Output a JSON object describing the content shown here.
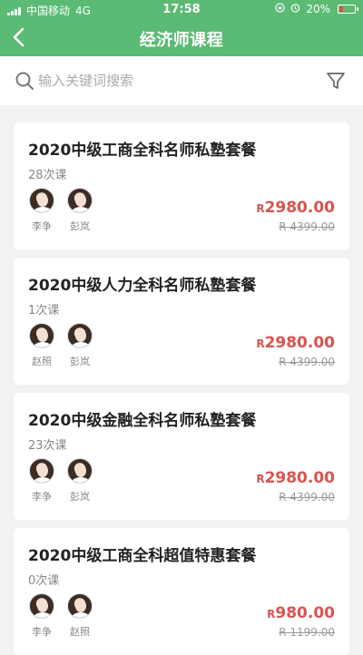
{
  "status_bar": {
    "carrier": "中国移动",
    "network": "4G",
    "time": "17:58",
    "battery": "20%",
    "battery_level": 0.2
  },
  "nav": {
    "title": "经济师课程"
  },
  "search": {
    "placeholder": "输入关键词搜索",
    "value": ""
  },
  "colors": {
    "header": "#5bba73",
    "price": "#d9534f"
  },
  "courses": [
    {
      "title": "2020中级工商全科名师私塾套餐",
      "count": "28次课",
      "teachers": [
        "李争",
        "彭岚"
      ],
      "currency": "R",
      "price": "2980.00",
      "original_price": "R 4399.00"
    },
    {
      "title": "2020中级人力全科名师私塾套餐",
      "count": "1次课",
      "teachers": [
        "赵照",
        "彭岚"
      ],
      "currency": "R",
      "price": "2980.00",
      "original_price": "R 4399.00"
    },
    {
      "title": "2020中级金融全科名师私塾套餐",
      "count": "23次课",
      "teachers": [
        "李争",
        "彭岚"
      ],
      "currency": "R",
      "price": "2980.00",
      "original_price": "R 4399.00"
    },
    {
      "title": "2020中级工商全科超值特惠套餐",
      "count": "0次课",
      "teachers": [
        "李争",
        "赵照"
      ],
      "currency": "R",
      "price": "980.00",
      "original_price": "R 1199.00"
    }
  ]
}
